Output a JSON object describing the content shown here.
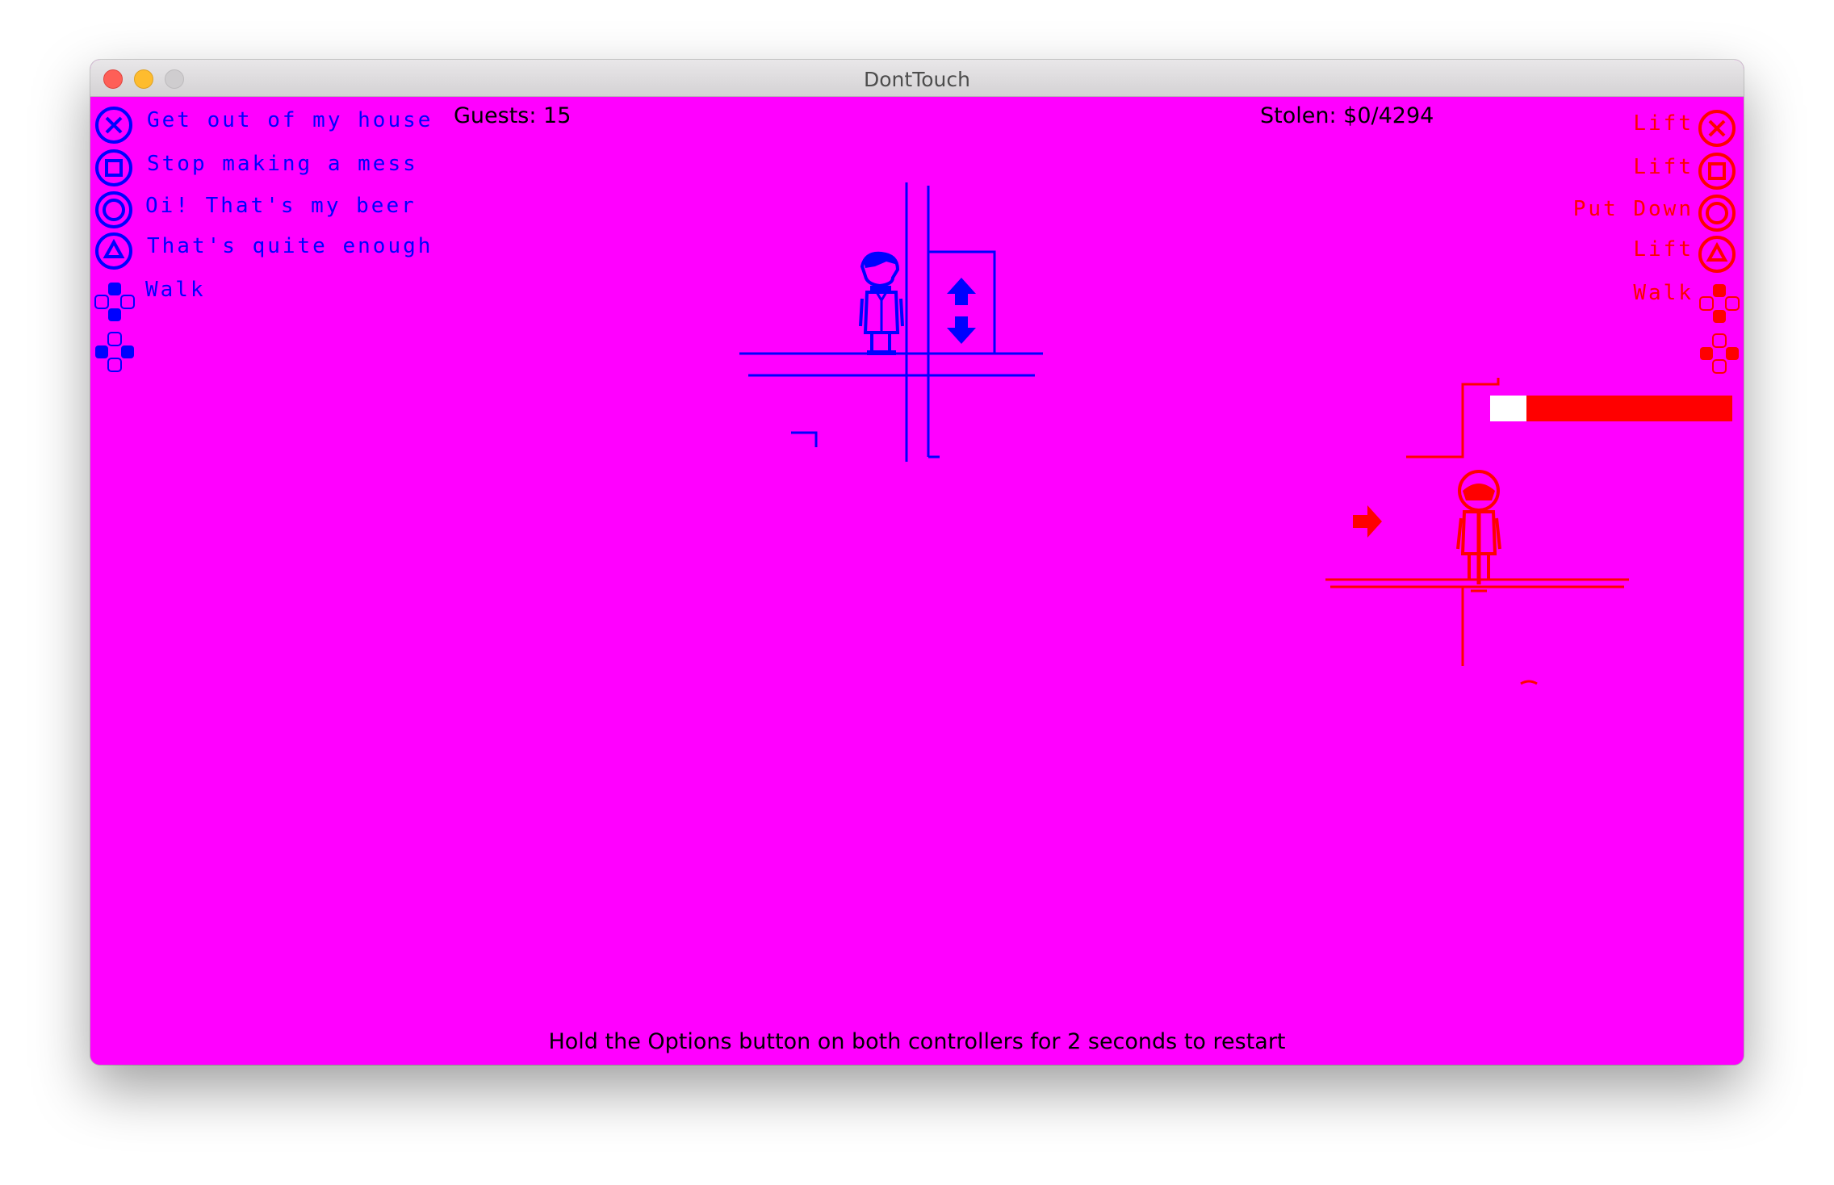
{
  "window": {
    "title": "DontTouch"
  },
  "hud": {
    "guests": "Guests: 15",
    "stolen": "Stolen: $0/4294",
    "restart_hint": "Hold the Options button on both controllers for 2 seconds to restart"
  },
  "player1": {
    "color": "#0000ff",
    "controls": [
      {
        "button": "cross-icon",
        "label": "Get out of my house"
      },
      {
        "button": "square-icon",
        "label": "Stop making a mess"
      },
      {
        "button": "circle-icon",
        "label": "Oi! That's my beer"
      },
      {
        "button": "triangle-icon",
        "label": "That's quite enough"
      },
      {
        "button": "dpad-up-icon",
        "label": "Walk"
      },
      {
        "button": "dpad-sides-icon",
        "label": ""
      }
    ]
  },
  "player2": {
    "color": "#ff0000",
    "controls": [
      {
        "button": "cross-icon",
        "label": "Lift"
      },
      {
        "button": "square-icon",
        "label": "Lift"
      },
      {
        "button": "circle-icon",
        "label": "Put Down"
      },
      {
        "button": "triangle-icon",
        "label": "Lift"
      },
      {
        "button": "dpad-up-icon",
        "label": "Walk"
      },
      {
        "button": "dpad-sides-icon",
        "label": ""
      }
    ],
    "meter_fill": 0.15
  },
  "colors": {
    "background": "#ff00ff",
    "player1": "#0000ff",
    "player2": "#ff0000",
    "meter_empty": "#ffffff"
  }
}
